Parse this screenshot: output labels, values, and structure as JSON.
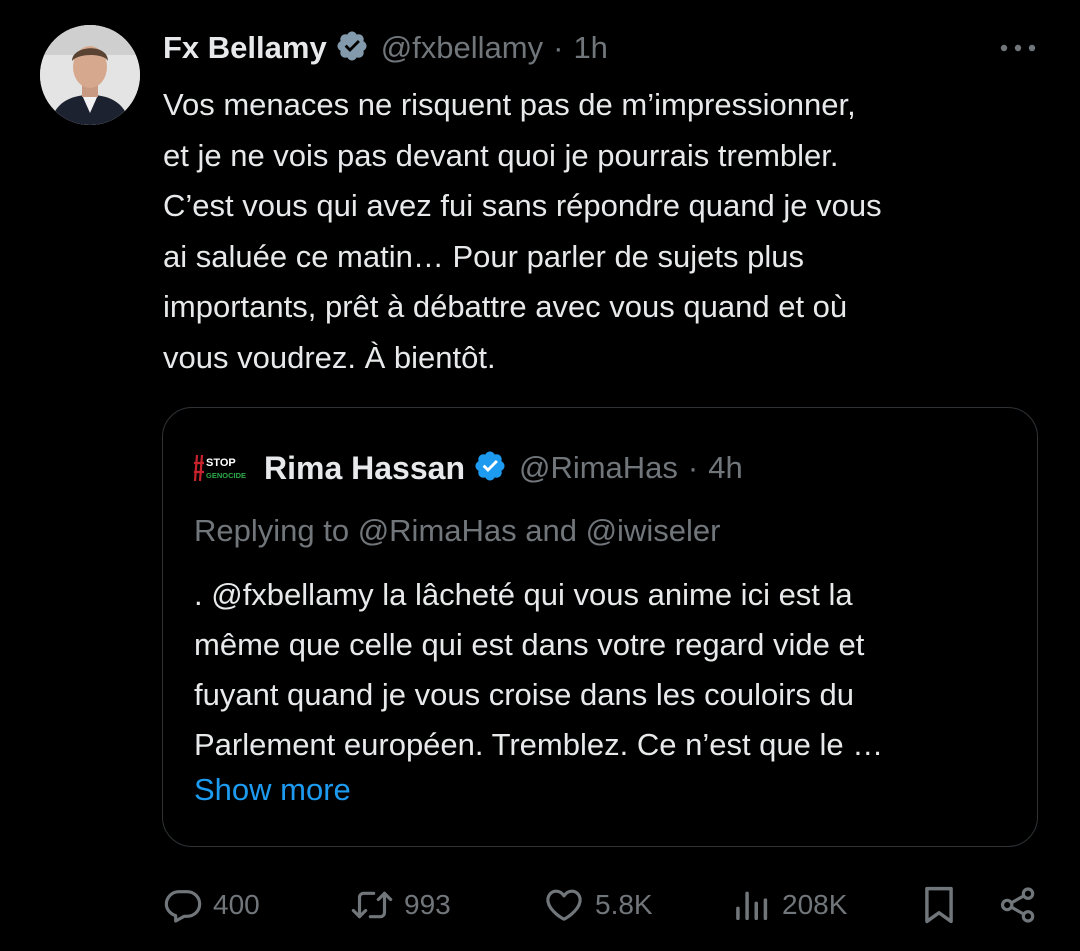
{
  "tweet": {
    "author": {
      "name": "Fx Bellamy",
      "handle": "@fxbellamy",
      "verified": true
    },
    "separator": "·",
    "time": "1h",
    "text": "Vos menaces ne risquent pas de m’impressionner,\net je ne vois pas devant quoi je pourrais trembler.\nC’est vous qui avez fui sans répondre quand je vous\nai saluée ce matin… Pour parler de sujets plus\nimportants, prêt à débattre avec vous quand et où\nvous voudrez. À bientôt."
  },
  "quoted_tweet": {
    "author": {
      "name": "Rima Hassan",
      "handle": "@RimaHas",
      "verified": true,
      "avatar_text_top": "STOP",
      "avatar_text_bottom": "GENOCIDE"
    },
    "separator": "·",
    "time": "4h",
    "reply_context": "Replying to @RimaHas and @iwiseler",
    "text": ". @fxbellamy la lâcheté qui vous anime ici est la\nmême que celle qui est dans votre regard vide et\nfuyant quand je vous croise dans les couloirs du\nParlement européen. Tremblez. Ce n’est que le …",
    "show_more": "Show more"
  },
  "actions": {
    "replies": "400",
    "retweets": "993",
    "likes": "5.8K",
    "views": "208K"
  },
  "icons": {
    "verified": "verified-badge-icon",
    "more": "more-options-icon",
    "reply": "reply-icon",
    "retweet": "retweet-icon",
    "like": "heart-icon",
    "views": "views-icon",
    "bookmark": "bookmark-icon",
    "share": "share-icon"
  },
  "colors": {
    "background": "#000000",
    "text_primary": "#e7e9ea",
    "text_secondary": "#71767b",
    "accent": "#1d9bf0",
    "border": "#2f3336"
  }
}
